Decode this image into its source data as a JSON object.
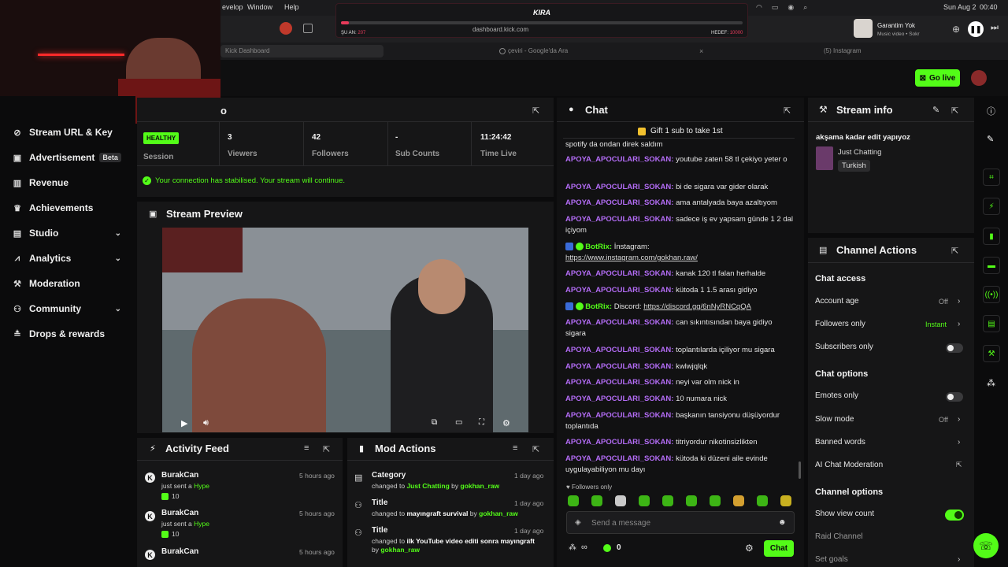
{
  "menubar": {
    "develop": "evelop",
    "window": "Window",
    "help": "Help",
    "date": "Sun Aug 2",
    "time": "00:40"
  },
  "overlay": {
    "brand": "KIRA",
    "now_label": "ŞU AN:",
    "now_value": "207",
    "goal_label": "HEDEF:",
    "goal_value": "10000"
  },
  "browser": {
    "url": "dashboard.kick.com"
  },
  "music": {
    "title": "Garantim Yok",
    "subtitle": "Music video • Sokr"
  },
  "tabs": [
    {
      "label": "Kick Dashboard"
    },
    {
      "label": "çeviri - Google'da Ara"
    },
    {
      "label": "(5) Instagram"
    }
  ],
  "header": {
    "go_live": "Go live"
  },
  "sidebar": {
    "items": [
      {
        "label": "Stream URL & Key"
      },
      {
        "label": "Advertisement",
        "badge": "Beta"
      },
      {
        "label": "Revenue"
      },
      {
        "label": "Achievements"
      },
      {
        "label": "Studio"
      },
      {
        "label": "Analytics"
      },
      {
        "label": "Moderation"
      },
      {
        "label": "Community"
      },
      {
        "label": "Drops & rewards"
      }
    ]
  },
  "session": {
    "title_fragment": "o",
    "status": "HEALTHY",
    "session_label": "Session",
    "stats": [
      {
        "value": "3",
        "label": "Viewers"
      },
      {
        "value": "42",
        "label": "Followers"
      },
      {
        "value": "-",
        "label": "Sub Counts"
      },
      {
        "value": "11:24:42",
        "label": "Time Live"
      }
    ],
    "connection_msg": "Your connection has stabilised. Your stream will continue."
  },
  "preview": {
    "title": "Stream Preview"
  },
  "activity": {
    "title": "Activity Feed",
    "items": [
      {
        "name": "BurakCan",
        "time": "5 hours ago",
        "action": "just sent a",
        "gift": "Hype",
        "amount": "10"
      },
      {
        "name": "BurakCan",
        "time": "5 hours ago",
        "action": "just sent a",
        "gift": "Hype",
        "amount": "10"
      },
      {
        "name": "BurakCan",
        "time": "5 hours ago"
      }
    ]
  },
  "mod_actions": {
    "title": "Mod Actions",
    "items": [
      {
        "kind": "Category",
        "time": "1 day ago",
        "prefix": "changed to",
        "value": "Just Chatting",
        "by": "by",
        "user": "gokhan_raw"
      },
      {
        "kind": "Title",
        "time": "1 day ago",
        "prefix": "changed to",
        "value": "mayıngraft survival",
        "by": "by",
        "user": "gokhan_raw"
      },
      {
        "kind": "Title",
        "time": "1 day ago",
        "prefix": "changed to",
        "value": "ilk YouTube video editi sonra mayıngraft",
        "by": "by",
        "user": "gokhan_raw"
      }
    ]
  },
  "chat": {
    "title": "Chat",
    "pinned": "Gift 1 sub to take 1st",
    "top_fragment": "spotify da ondan direk saldım",
    "messages": [
      {
        "user": "APOYA_APOCULARI_SOKAN:",
        "text": "youtube zaten 58 tl çekiyo yeter o"
      },
      {
        "user": "APOYA_APOCULARI_SOKAN:",
        "text": "bi de sigara var gider olarak"
      },
      {
        "user": "APOYA_APOCULARI_SOKAN:",
        "text": "ama antalyada baya azaltıyom"
      },
      {
        "user": "APOYA_APOCULARI_SOKAN:",
        "text": "sadece iş ev yapsam günde 1 2 dal içiyom"
      },
      {
        "user": "BotRix:",
        "text": "İnstagram:",
        "link": "https://www.instagram.com/gokhan.raw/"
      },
      {
        "user": "APOYA_APOCULARI_SOKAN:",
        "text": "kanak 120 tl falan herhalde"
      },
      {
        "user": "APOYA_APOCULARI_SOKAN:",
        "text": "kütoda 1 1.5 arası gidiyo"
      },
      {
        "user": "BotRix:",
        "text": "Discord:",
        "link": "https://discord.gg/6nNyRNCqQA"
      },
      {
        "user": "APOYA_APOCULARI_SOKAN:",
        "text": "can sıkıntısından baya gidiyo sigara"
      },
      {
        "user": "APOYA_APOCULARI_SOKAN:",
        "text": "toplantılarda içiliyor mu sigara"
      },
      {
        "user": "APOYA_APOCULARI_SOKAN:",
        "text": "kwlwjqlqk"
      },
      {
        "user": "APOYA_APOCULARI_SOKAN:",
        "text": "neyi var olm nick in"
      },
      {
        "user": "APOYA_APOCULARI_SOKAN:",
        "text": "10 numara nick"
      },
      {
        "user": "APOYA_APOCULARI_SOKAN:",
        "text": "başkanın tansiyonu düşüyordur toplantıda"
      },
      {
        "user": "APOYA_APOCULARI_SOKAN:",
        "text": "titriyordur nikotinsizlikten"
      },
      {
        "user": "APOYA_APOCULARI_SOKAN:",
        "text": "kütoda ki düzeni aile evinde uygulayabiliyon mu dayı"
      }
    ],
    "followers_only": "Followers only",
    "placeholder": "Send a message",
    "count": "0",
    "send_label": "Chat"
  },
  "stream_info": {
    "title": "Stream info",
    "stream_title": "akşama kadar edit yapıyoz",
    "category": "Just Chatting",
    "tag": "Turkish"
  },
  "channel_actions": {
    "title": "Channel Actions",
    "chat_access": "Chat access",
    "account_age": {
      "label": "Account age",
      "value": "Off"
    },
    "followers_only": {
      "label": "Followers only",
      "value": "Instant"
    },
    "subscribers_only": {
      "label": "Subscribers only"
    },
    "chat_options": "Chat options",
    "emotes_only": {
      "label": "Emotes only"
    },
    "slow_mode": {
      "label": "Slow mode",
      "value": "Off"
    },
    "banned_words": {
      "label": "Banned words"
    },
    "ai_moderation": {
      "label": "AI Chat Moderation"
    },
    "channel_options": "Channel options",
    "show_view_count": {
      "label": "Show view count"
    },
    "raid_channel": {
      "label": "Raid Channel"
    },
    "cut_label": "Set goals"
  },
  "colors": {
    "accent": "#53fc18",
    "chat_user": "#b36cf5",
    "bg": "#0b0b0c",
    "panel": "#161617"
  }
}
